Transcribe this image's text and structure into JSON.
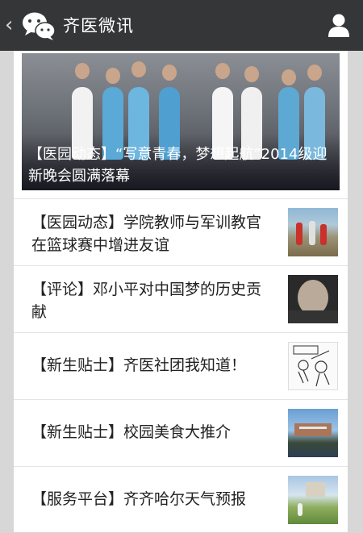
{
  "header": {
    "title": "齐医微讯",
    "back_icon": "chevron-left-icon",
    "logo_icon": "wechat-logo-icon",
    "profile_icon": "user-profile-icon"
  },
  "hero": {
    "caption": "【医园动态】“写意青春，梦想起航”2014级迎新晚会圆满落幕",
    "image": "photo-students-on-stage"
  },
  "articles": [
    {
      "title": "【医园动态】学院教师与军训教官在篮球赛中增进友谊",
      "thumbnail": "photo-basketball-game"
    },
    {
      "title": "【评论】邓小平对中国梦的历史贡献",
      "thumbnail": "photo-portrait"
    },
    {
      "title": "【新生贴士】齐医社团我知道！",
      "thumbnail": "cartoon-clubs"
    },
    {
      "title": "【新生贴士】校园美食大推介",
      "thumbnail": "photo-campus-building"
    },
    {
      "title": "【服务平台】齐齐哈尔天气预报",
      "thumbnail": "photo-crane-wetland"
    }
  ],
  "colors": {
    "header_bg": "#343637",
    "page_bg": "#d7d7d7",
    "card_bg": "#ffffff"
  }
}
